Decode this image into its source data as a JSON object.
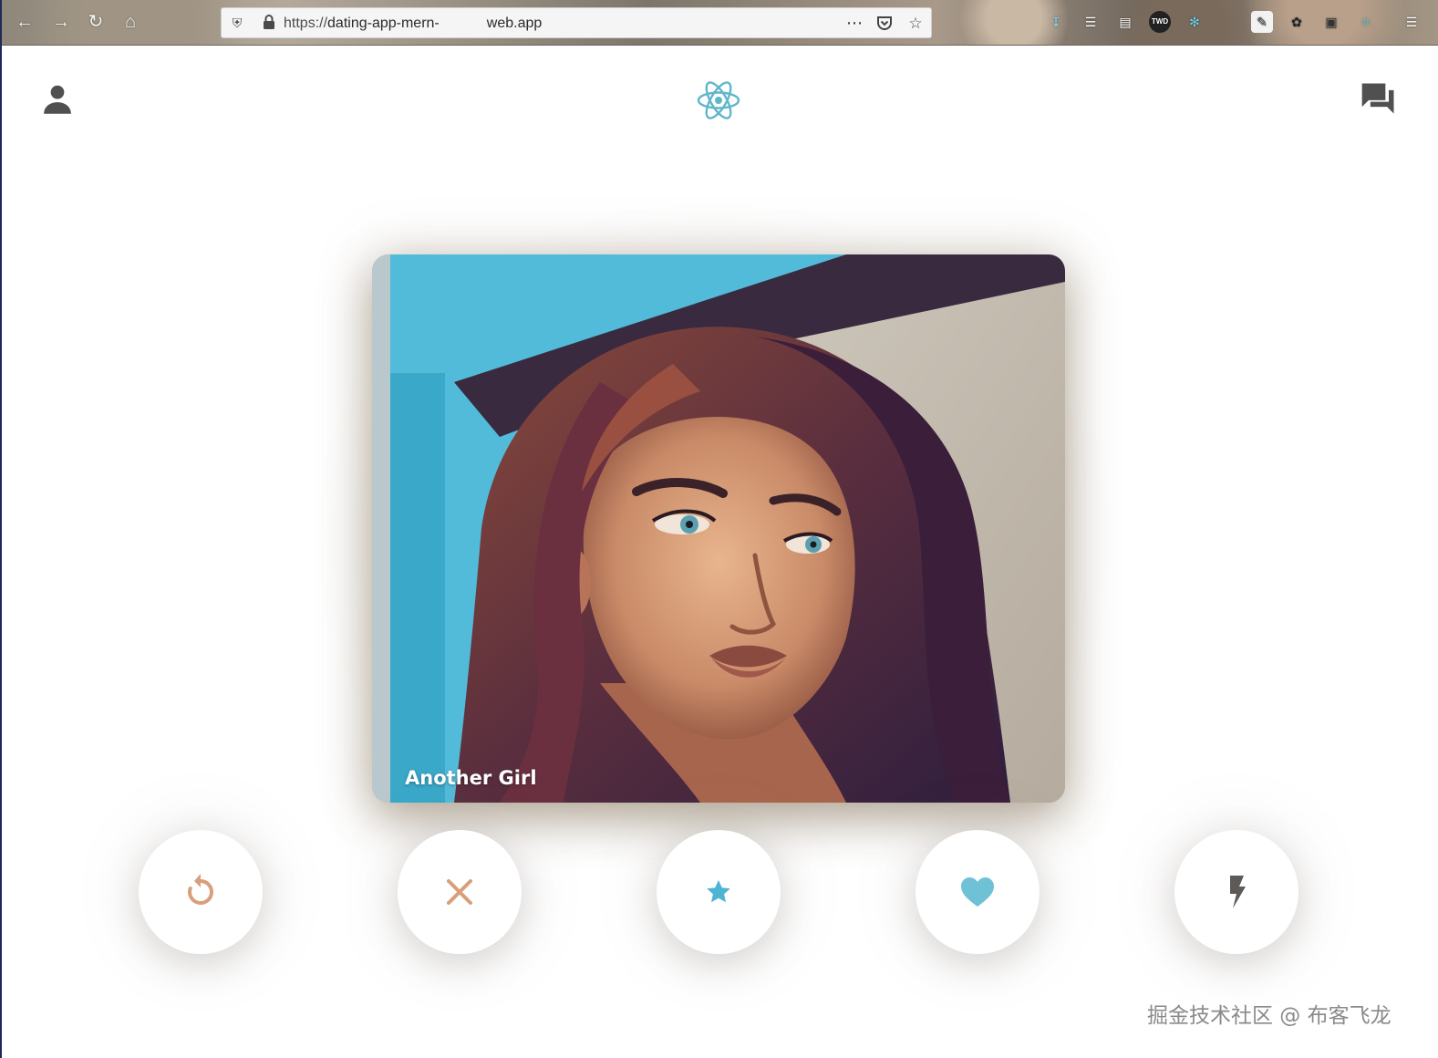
{
  "browser": {
    "url_prefix": "https://",
    "url_host_start": "dating-app-mern-",
    "url_host_end": "web.app",
    "nav_icons": [
      "back-arrow-icon",
      "forward-arrow-icon",
      "reload-icon",
      "home-icon"
    ],
    "url_icons": [
      "shield-icon",
      "lock-icon",
      "meatball-menu-icon",
      "pocket-icon",
      "bookmark-star-icon"
    ],
    "extension_icons": [
      "download-icon",
      "library-icon",
      "reader-icon",
      "twd-extension-icon",
      "react-devtools-icon",
      "notes-icon",
      "extension-icon",
      "screenshot-icon",
      "react-icon",
      "hamburger-menu-icon"
    ],
    "ext_twd_label": "TWD"
  },
  "header": {
    "left_icon": "person-icon",
    "center_icon": "react-atom-logo-icon",
    "right_icon": "forum-chat-icon",
    "icon_color": "#505050",
    "logo_color": "#5fb7c9"
  },
  "card": {
    "name": "Another Girl"
  },
  "swipe_buttons": [
    {
      "id": "repeat",
      "icon": "replay-icon",
      "color": "#d8a07a"
    },
    {
      "id": "close",
      "icon": "close-icon",
      "color": "#d8a07a"
    },
    {
      "id": "star",
      "icon": "star-icon",
      "color": "#4fb4d4"
    },
    {
      "id": "heart",
      "icon": "heart-icon",
      "color": "#6fc2d6"
    },
    {
      "id": "flash",
      "icon": "flash-icon",
      "color": "#5e5a57"
    }
  ],
  "watermark": {
    "text": "掘金技术社区 @ 布客飞龙"
  }
}
